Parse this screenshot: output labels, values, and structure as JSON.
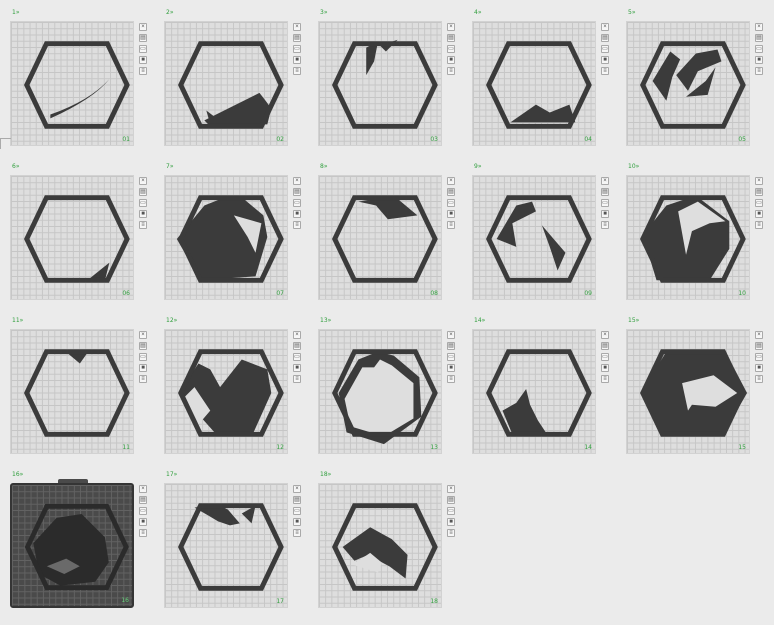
{
  "plates": [
    {
      "label": "1»",
      "number": "01",
      "selected": false
    },
    {
      "label": "2»",
      "number": "02",
      "selected": false
    },
    {
      "label": "3»",
      "number": "03",
      "selected": false
    },
    {
      "label": "4»",
      "number": "04",
      "selected": false
    },
    {
      "label": "5»",
      "number": "05",
      "selected": false
    },
    {
      "label": "6»",
      "number": "06",
      "selected": false
    },
    {
      "label": "7»",
      "number": "07",
      "selected": false
    },
    {
      "label": "8»",
      "number": "08",
      "selected": false
    },
    {
      "label": "9»",
      "number": "09",
      "selected": false
    },
    {
      "label": "10»",
      "number": "10",
      "selected": false
    },
    {
      "label": "11»",
      "number": "11",
      "selected": false
    },
    {
      "label": "12»",
      "number": "12",
      "selected": false
    },
    {
      "label": "13»",
      "number": "13",
      "selected": false
    },
    {
      "label": "14»",
      "number": "14",
      "selected": false
    },
    {
      "label": "15»",
      "number": "15",
      "selected": false
    },
    {
      "label": "16»",
      "number": "16",
      "selected": true
    },
    {
      "label": "17»",
      "number": "17",
      "selected": false
    },
    {
      "label": "18»",
      "number": "18",
      "selected": false
    }
  ],
  "plate_tools": [
    {
      "name": "close-icon",
      "glyph": "×"
    },
    {
      "name": "arrange-icon",
      "glyph": "▤"
    },
    {
      "name": "orient-icon",
      "glyph": "▭"
    },
    {
      "name": "lock-icon",
      "glyph": "■"
    },
    {
      "name": "settings-icon",
      "glyph": "≡"
    }
  ],
  "colors": {
    "accent": "#2f9e3c",
    "part": "#3b3b3b",
    "bed": "#dedede",
    "selected_bed": "#4a4a4a"
  }
}
